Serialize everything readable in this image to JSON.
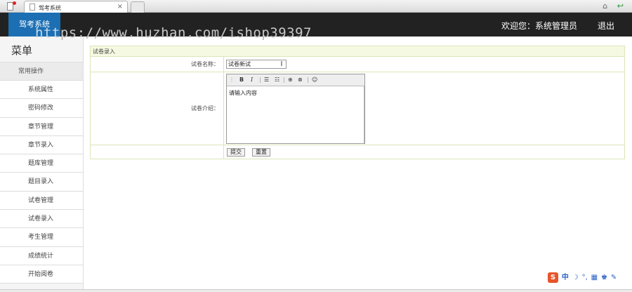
{
  "browser": {
    "tab_title": "驾考系统",
    "tab_close": "×",
    "home_glyph": "⌂",
    "back_glyph": "↩"
  },
  "header": {
    "logo_text": "驾考系统",
    "welcome": "欢迎您：系统管理员",
    "logout": "退出",
    "watermark": "https://www.huzhan.com/ishop39397",
    "brand_color": "#1c6fb3",
    "bar_color": "#222222"
  },
  "sidebar": {
    "title": "菜单",
    "group": "常用操作",
    "items": [
      {
        "label": "系统属性"
      },
      {
        "label": "密码修改"
      },
      {
        "label": "章节管理"
      },
      {
        "label": "章节录入"
      },
      {
        "label": "题库管理"
      },
      {
        "label": "题目录入"
      },
      {
        "label": "试卷管理"
      },
      {
        "label": "试卷录入"
      },
      {
        "label": "考生管理"
      },
      {
        "label": "成绩统计"
      },
      {
        "label": "开始阅卷"
      }
    ]
  },
  "form": {
    "caption": "试卷录入",
    "name_label": "试卷名称：",
    "name_value": "试卷新试",
    "desc_label": "试卷介绍：",
    "editor": {
      "toolbar": {
        "bold": "B",
        "italic": "I",
        "ol": "☰",
        "ul": "☷",
        "link": "⊕",
        "unlink": "⊗",
        "smiley": "☺"
      },
      "content": "请输入内容"
    },
    "submit_label": "提交",
    "reset_label": "重置"
  },
  "ime": {
    "logo": "S",
    "mode": "中",
    "icons": [
      "☽",
      "°,",
      "▦",
      "♚",
      "✎"
    ]
  }
}
